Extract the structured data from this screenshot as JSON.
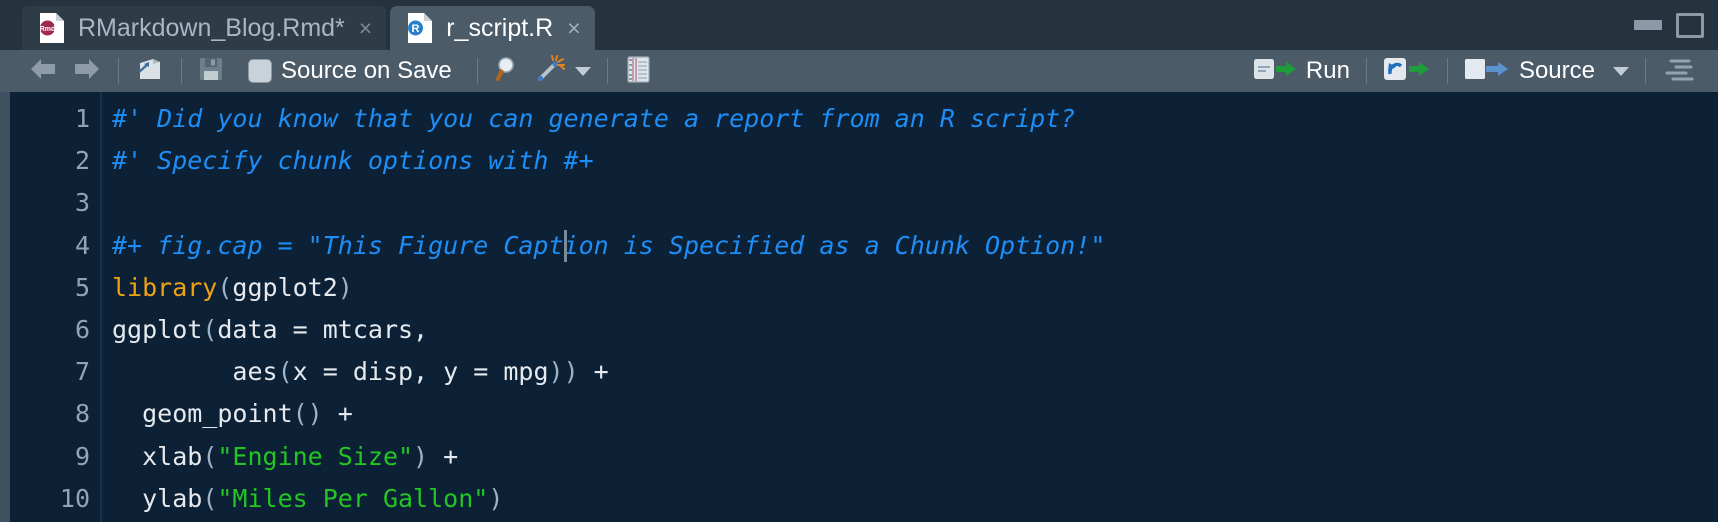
{
  "window": {
    "controls": [
      {
        "name": "minimize",
        "icon": "minimize-icon"
      },
      {
        "name": "maximize",
        "icon": "maximize-icon"
      }
    ]
  },
  "tabs": [
    {
      "label": "RMarkdown_Blog.Rmd*",
      "icon": "rmarkdown-file-icon",
      "icon_text": "Rmd",
      "close_glyph": "×",
      "active": false,
      "modified": true
    },
    {
      "label": "r_script.R",
      "icon": "r-file-icon",
      "icon_text": "R",
      "close_glyph": "×",
      "active": true,
      "modified": false
    }
  ],
  "toolbar": {
    "back_label": "",
    "forward_label": "",
    "popout_label": "",
    "save_label": "",
    "source_on_save_label": "Source on Save",
    "source_on_save_checked": false,
    "find_label": "",
    "codetools_label": "",
    "compile_report_label": "",
    "run_label": "Run",
    "rerun_label": "",
    "source_label": "Source",
    "outline_label": ""
  },
  "colors": {
    "editor_background": "#0d2136",
    "toolbar_background": "#4b5b68",
    "tabbar_background": "#25333f",
    "tab_active_background": "#4b5b68",
    "tab_inactive_background": "#2e3c48",
    "comment": "#1e8ef7",
    "keyword": "#f0a013",
    "string": "#22c523",
    "plain_text": "#e6eaee",
    "line_number": "#93a3b1",
    "run_arrow": "#1f9d3d",
    "source_arrow": "#5b92d0",
    "r_icon_blue": "#2a7fc9",
    "rmd_icon_red": "#9e2b4c"
  },
  "editor": {
    "cursor": {
      "line": 4,
      "column": 31
    },
    "lines": [
      {
        "number": "1",
        "tokens": [
          {
            "type": "comment",
            "text": "#' Did you know that you can generate a report from an R script?"
          }
        ]
      },
      {
        "number": "2",
        "tokens": [
          {
            "type": "comment",
            "text": "#' Specify chunk options with #+"
          }
        ]
      },
      {
        "number": "3",
        "tokens": [
          {
            "type": "plain",
            "text": ""
          }
        ]
      },
      {
        "number": "4",
        "tokens": [
          {
            "type": "comment",
            "text": "#+ fig.cap = \"This Figure Caption is Specified as a Chunk Option!\""
          }
        ]
      },
      {
        "number": "5",
        "tokens": [
          {
            "type": "keyword",
            "text": "library"
          },
          {
            "type": "paren",
            "text": "("
          },
          {
            "type": "plain",
            "text": "ggplot2"
          },
          {
            "type": "paren",
            "text": ")"
          }
        ]
      },
      {
        "number": "6",
        "tokens": [
          {
            "type": "plain",
            "text": "ggplot"
          },
          {
            "type": "paren",
            "text": "("
          },
          {
            "type": "plain",
            "text": "data = mtcars,"
          }
        ]
      },
      {
        "number": "7",
        "tokens": [
          {
            "type": "plain",
            "text": "        aes"
          },
          {
            "type": "paren",
            "text": "("
          },
          {
            "type": "plain",
            "text": "x = disp, y = mpg"
          },
          {
            "type": "paren",
            "text": "))"
          },
          {
            "type": "plain",
            "text": " +"
          }
        ]
      },
      {
        "number": "8",
        "tokens": [
          {
            "type": "plain",
            "text": "  geom_point"
          },
          {
            "type": "paren",
            "text": "()"
          },
          {
            "type": "plain",
            "text": " +"
          }
        ]
      },
      {
        "number": "9",
        "tokens": [
          {
            "type": "plain",
            "text": "  xlab"
          },
          {
            "type": "paren",
            "text": "("
          },
          {
            "type": "string",
            "text": "\"Engine Size\""
          },
          {
            "type": "paren",
            "text": ")"
          },
          {
            "type": "plain",
            "text": " +"
          }
        ]
      },
      {
        "number": "10",
        "tokens": [
          {
            "type": "plain",
            "text": "  ylab"
          },
          {
            "type": "paren",
            "text": "("
          },
          {
            "type": "string",
            "text": "\"Miles Per Gallon\""
          },
          {
            "type": "paren",
            "text": ")"
          }
        ]
      }
    ]
  }
}
